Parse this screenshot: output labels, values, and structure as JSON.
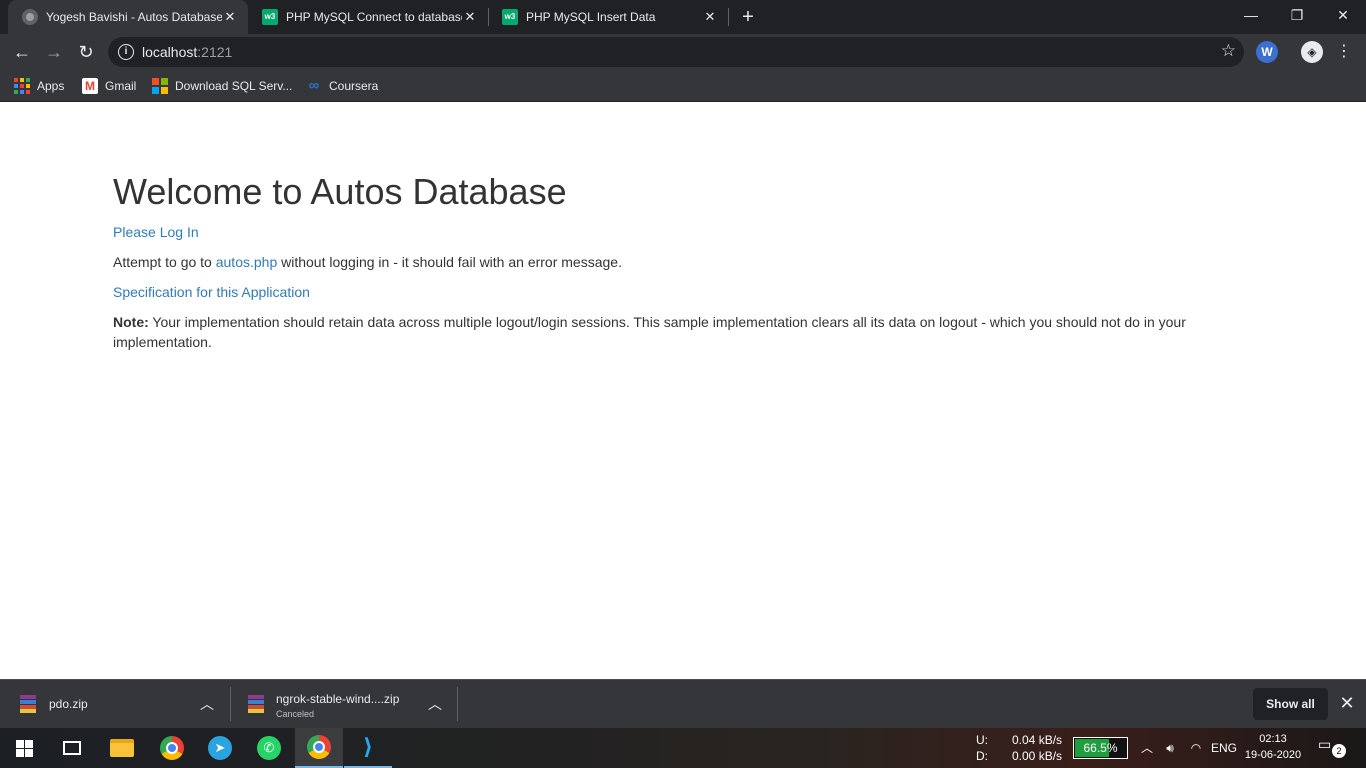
{
  "browser": {
    "tabs": [
      {
        "title": "Yogesh Bavishi - Autos Database",
        "icon": "globe-icon",
        "active": true
      },
      {
        "title": "PHP MySQL Connect to database",
        "icon": "w3schools-icon",
        "active": false
      },
      {
        "title": "PHP MySQL Insert Data",
        "icon": "w3schools-icon",
        "active": false
      }
    ],
    "new_tab_glyph": "+",
    "window_controls": {
      "minimize": "—",
      "restore": "❐",
      "close": "✕"
    },
    "address": {
      "host": "localhost",
      "port": ":2121"
    },
    "extensions": [
      {
        "label": "W",
        "icon": "wikiwand-extension-icon"
      },
      {
        "label": "◈",
        "icon": "shield-extension-icon"
      }
    ],
    "bookmarks": [
      {
        "label": "Apps",
        "icon": "apps-grid-icon"
      },
      {
        "label": "Gmail",
        "icon": "gmail-icon"
      },
      {
        "label": "Download SQL Serv...",
        "icon": "microsoft-icon"
      },
      {
        "label": "Coursera",
        "icon": "coursera-icon"
      }
    ]
  },
  "page": {
    "heading": "Welcome to Autos Database",
    "login_link": "Please Log In",
    "attempt_prefix": "Attempt to go to ",
    "attempt_link": "autos.php",
    "attempt_suffix": " without logging in - it should fail with an error message.",
    "spec_link": "Specification for this Application",
    "note_label": "Note:",
    "note_text": " Your implementation should retain data across multiple logout/login sessions. This sample implementation clears all its data on logout - which you should not do in your implementation."
  },
  "downloads": {
    "items": [
      {
        "name": "pdo.zip",
        "status": ""
      },
      {
        "name": "ngrok-stable-wind....zip",
        "status": "Canceled"
      }
    ],
    "show_all_label": "Show all"
  },
  "taskbar": {
    "apps": [
      "windows-start-icon",
      "task-view-icon",
      "file-explorer-icon",
      "chrome-icon",
      "telegram-icon",
      "whatsapp-icon",
      "chrome-profile-icon",
      "vscode-icon"
    ],
    "net_upload_label": "U:",
    "net_upload": "0.04 kB/s",
    "net_download_label": "D:",
    "net_download": "0.00 kB/s",
    "battery": "66.5%",
    "battery_level": 0.665,
    "language": "ENG",
    "time": "02:13",
    "date": "19-06-2020",
    "notifications": "2"
  },
  "colors": {
    "link": "#337ab7",
    "text": "#333333",
    "chrome_dark": "#202124",
    "chrome_toolbar": "#35363a",
    "battery_fill": "#1e9e3e"
  }
}
